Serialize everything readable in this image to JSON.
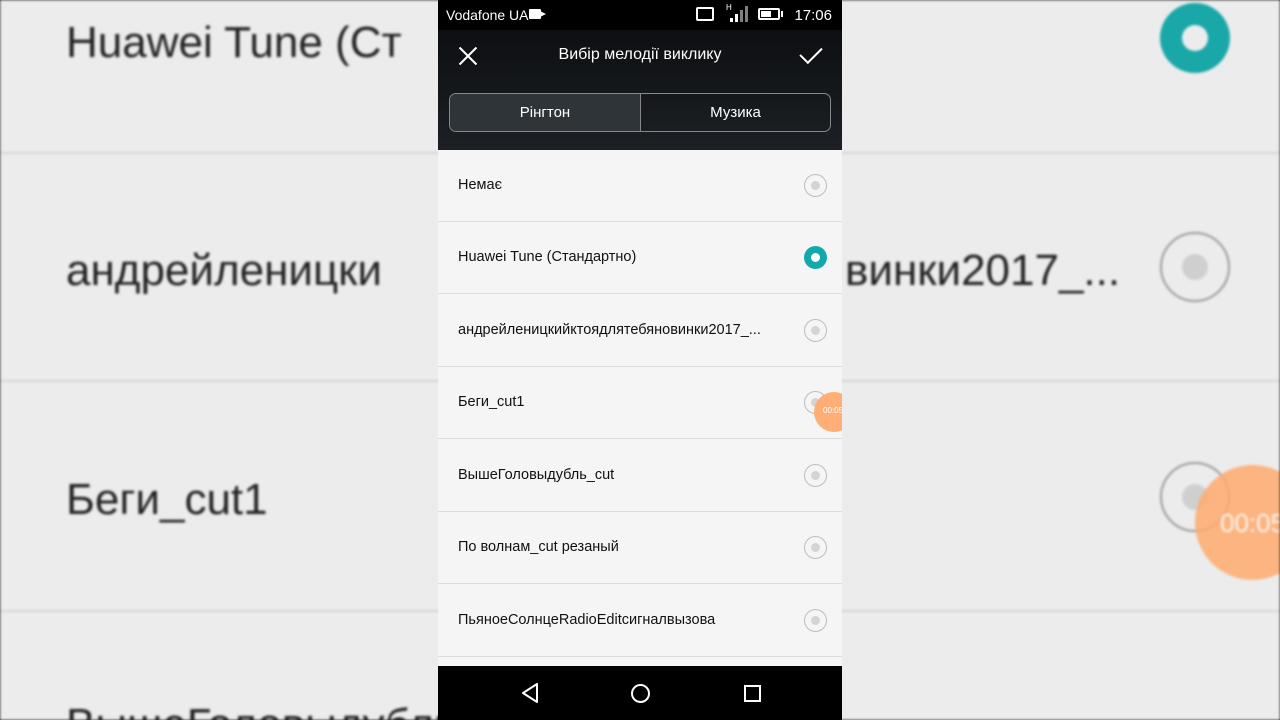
{
  "background": {
    "rows": [
      "Huawei Tune (Ст",
      "андрейленицки",
      "винки2017_...",
      "Беги_cut1",
      "ВышеГоловыдубль_cut"
    ],
    "timer": "00:05"
  },
  "status_bar": {
    "carrier": "Vodafone UA",
    "time": "17:06",
    "network_label": "H"
  },
  "header": {
    "title": "Вибір мелодії виклику"
  },
  "tabs": [
    {
      "label": "Рінгтон",
      "active": true
    },
    {
      "label": "Музика",
      "active": false
    }
  ],
  "ringtones": [
    {
      "label": "Немає",
      "selected": false
    },
    {
      "label": "Huawei Tune (Стандартно)",
      "selected": true
    },
    {
      "label": "андрейленицкийктоядлятебяновинки2017_...",
      "selected": false
    },
    {
      "label": "Беги_cut1",
      "selected": false
    },
    {
      "label": "ВышеГоловыдубль_cut",
      "selected": false
    },
    {
      "label": "По волнам_cut резаный",
      "selected": false
    },
    {
      "label": "ПьяноеСолнцеRadioEditсигналвызова",
      "selected": false
    }
  ],
  "touch_indicator": "00:05",
  "colors": {
    "accent": "#12a9ac",
    "header_bg": "#0d0f12",
    "list_bg": "#f5f5f5"
  }
}
